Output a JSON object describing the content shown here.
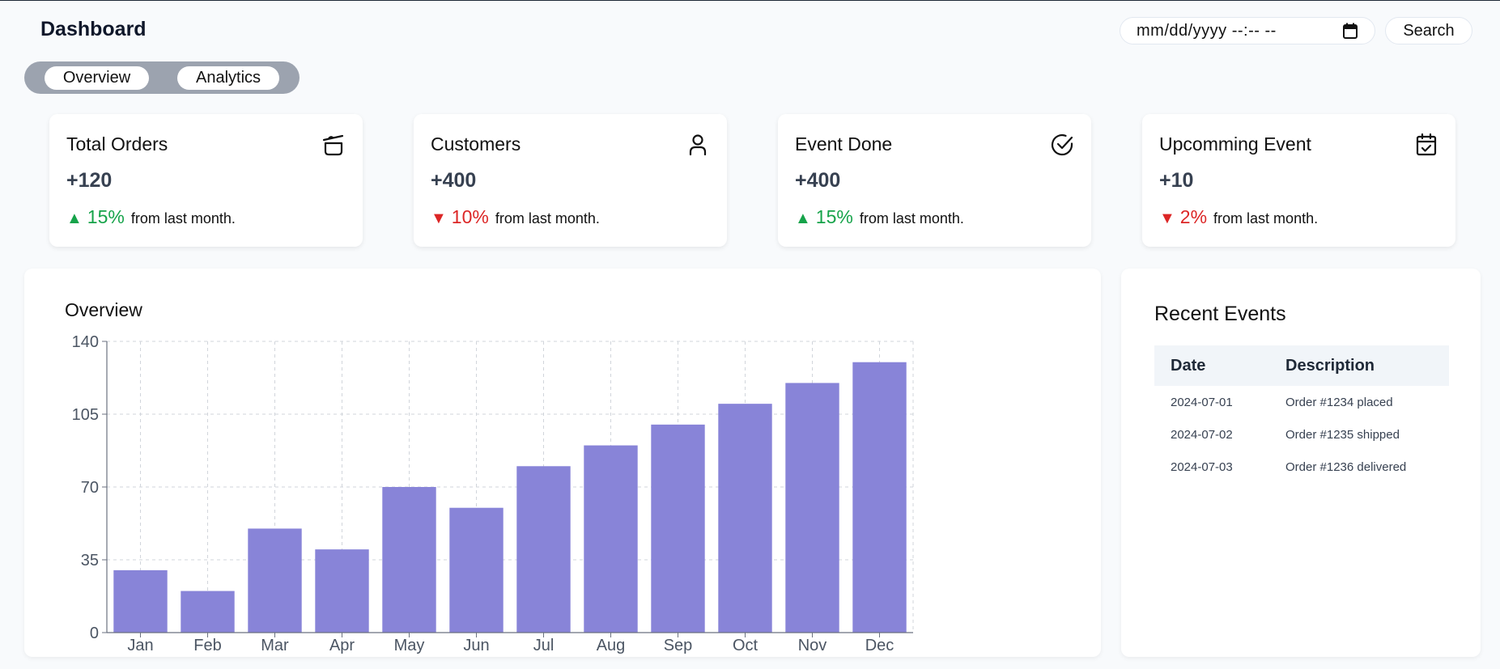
{
  "header": {
    "title": "Dashboard",
    "date_placeholder": "mm/dd/yyyy --:-- --",
    "search_label": "Search"
  },
  "tabs": [
    {
      "label": "Overview"
    },
    {
      "label": "Analytics"
    }
  ],
  "stats": [
    {
      "title": "Total Orders",
      "value": "+120",
      "direction": "up",
      "change": "15%",
      "note": "from last month.",
      "icon": "pot-icon"
    },
    {
      "title": "Customers",
      "value": "+400",
      "direction": "down",
      "change": "10%",
      "note": "from last month.",
      "icon": "user-icon"
    },
    {
      "title": "Event Done",
      "value": "+400",
      "direction": "up",
      "change": "15%",
      "note": "from last month.",
      "icon": "check-circle-icon"
    },
    {
      "title": "Upcomming Event",
      "value": "+10",
      "direction": "down",
      "change": "2%",
      "note": "from last month.",
      "icon": "calendar-check-icon"
    }
  ],
  "arrows": {
    "up": "▲",
    "down": "▼"
  },
  "colors": {
    "up": "#16a34a",
    "down": "#dc2626",
    "bar": "#8884d8"
  },
  "overview": {
    "title": "Overview"
  },
  "chart_data": {
    "type": "bar",
    "categories": [
      "Jan",
      "Feb",
      "Mar",
      "Apr",
      "May",
      "Jun",
      "Jul",
      "Aug",
      "Sep",
      "Oct",
      "Nov",
      "Dec"
    ],
    "values": [
      30,
      20,
      50,
      40,
      70,
      60,
      80,
      90,
      100,
      110,
      120,
      130
    ],
    "ylim": [
      0,
      140
    ],
    "yticks": [
      0,
      35,
      70,
      105,
      140
    ],
    "grid": true,
    "color": "#8884d8"
  },
  "recent_events": {
    "title": "Recent Events",
    "columns": [
      "Date",
      "Description"
    ],
    "rows": [
      {
        "date": "2024-07-01",
        "description": "Order #1234 placed"
      },
      {
        "date": "2024-07-02",
        "description": "Order #1235 shipped"
      },
      {
        "date": "2024-07-03",
        "description": "Order #1236 delivered"
      }
    ]
  }
}
